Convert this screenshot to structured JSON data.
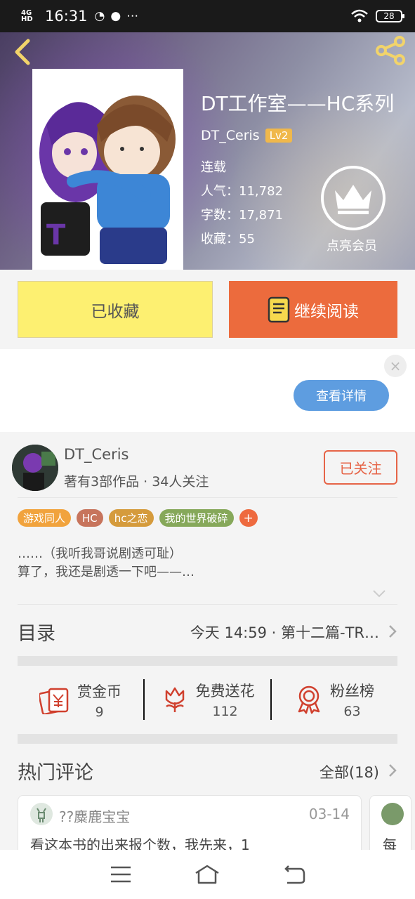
{
  "status_bar": {
    "network": "4G HD",
    "time": "16:31",
    "battery": "28"
  },
  "book": {
    "title": "DT工作室——HC系列",
    "author": "DT_Ceris",
    "level": "Lv2",
    "status": "连载",
    "popularity": "人气：11,782",
    "words": "字数：17,871",
    "favorites": "收藏：55"
  },
  "vip": {
    "label": "点亮会员"
  },
  "actions": {
    "favorited": "已收藏",
    "continue_reading": "继续阅读"
  },
  "ad": {
    "detail_button": "查看详情",
    "close": "×"
  },
  "author": {
    "name": "DT_Ceris",
    "subtitle": "著有3部作品 · 34人关注",
    "follow_button": "已关注"
  },
  "tags": [
    {
      "label": "游戏同人",
      "color": "#f1a33d"
    },
    {
      "label": "HC",
      "color": "#c7745c"
    },
    {
      "label": "hc之恋",
      "color": "#d59b3c"
    },
    {
      "label": "我的世界破碎",
      "color": "#86a85a"
    },
    {
      "label": "+",
      "color": "#ee6a3f"
    }
  ],
  "intro": {
    "line1": "……（我听我哥说剧透可耻）",
    "line2": "算了，我还是剧透一下吧——…"
  },
  "toc": {
    "title": "目录",
    "latest": "今天 14:59 · 第十二篇-TR…"
  },
  "stats": [
    {
      "label": "赏金币",
      "value": "9",
      "icon": "coin-envelope-icon"
    },
    {
      "label": "免费送花",
      "value": "112",
      "icon": "flower-icon"
    },
    {
      "label": "粉丝榜",
      "value": "63",
      "icon": "medal-icon"
    }
  ],
  "comments": {
    "title": "热门评论",
    "all": "全部(18)",
    "items": [
      {
        "user": "??麋鹿宝宝",
        "date": "03-14",
        "text": "看这本书的出来报个数，我先来，1"
      },
      {
        "text": "每"
      }
    ]
  },
  "colors": {
    "accent": "#ec6b3d",
    "favorite_yellow": "#fdf071",
    "follow_red": "#e66447",
    "detail_blue": "#5e9de0"
  }
}
